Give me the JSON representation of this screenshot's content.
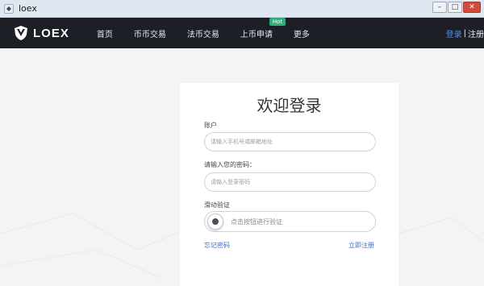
{
  "window": {
    "title": "loex",
    "minimize": "–",
    "maximize": "□",
    "close": "✕"
  },
  "brand": {
    "name": "LOEX"
  },
  "nav": {
    "items": [
      {
        "label": "首页"
      },
      {
        "label": "币币交易"
      },
      {
        "label": "法币交易"
      },
      {
        "label": "上币申请",
        "badge": "Hot"
      },
      {
        "label": "更多"
      }
    ]
  },
  "auth": {
    "login": "登录",
    "separator": "|",
    "register": "注册"
  },
  "login_form": {
    "title": "欢迎登录",
    "account_label": "账户",
    "account_placeholder": "请输入手机号或邮箱地址",
    "password_label": "请输入您的密码：",
    "password_placeholder": "请输入登录密码",
    "slider_label": "滑动验证",
    "slider_text": "点击按钮进行验证",
    "forgot_link": "忘记密码",
    "register_link": "立即注册"
  },
  "colors": {
    "navbar": "#1c1f26",
    "accent": "#3a6fd8",
    "badge": "#2ab27b"
  }
}
